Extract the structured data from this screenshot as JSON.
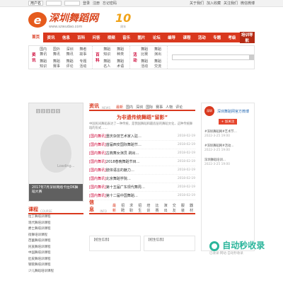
{
  "topbar": {
    "account_select": "用户名",
    "links": [
      "登录",
      "注册",
      "忘记密码"
    ],
    "right_links": [
      "关于我们",
      "加入收藏",
      "关注我们"
    ],
    "weixin": "微信微博"
  },
  "header": {
    "logo_letter": "e",
    "site_name": "深圳舞蹈网",
    "site_url": "www.szwudao.com",
    "anniv_number": "10",
    "anniv_sub": "周年"
  },
  "nav": {
    "items": [
      "首页",
      "资讯",
      "信息",
      "百科",
      "问答",
      "视频",
      "音乐",
      "图片",
      "论坛",
      "编导",
      "课程",
      "活动",
      "专题",
      "考级"
    ],
    "category": "培训导航"
  },
  "subnav": {
    "groups": [
      {
        "head": "资讯",
        "items": [
          "国内舞讯",
          "国外舞讯",
          "深圳舞讯",
          "舞者故事",
          "舞蹈知识",
          "舞蹈赛事",
          "舞蹈评论",
          "专题活动"
        ]
      },
      {
        "head": "百科",
        "items": [
          "舞蹈知识",
          "舞蹈种类",
          "舞蹈名人",
          "舞蹈术语"
        ]
      },
      {
        "head": "活动",
        "items": [
          "舞蹈比赛",
          "舞蹈演出",
          "舞蹈活动",
          "舞蹈交流"
        ]
      }
    ]
  },
  "slider": {
    "dots": [
      "1",
      "2",
      "3",
      "4",
      "5"
    ],
    "loading": "Loading...",
    "caption": "2017年7月深圳网络卡拉OK舞蹈大赛"
  },
  "news": {
    "title": "资讯",
    "en": "NEWS",
    "tabs": [
      "最新",
      "国内",
      "深圳",
      "国际",
      "赛事",
      "人物",
      "评论"
    ],
    "headline": "为非遗传统舞蹈“留影”",
    "summary": "中国民间舞蹈表达了一种传统，是我国舞蹈和最底层的舞蹈文化，这种传统舞蹈的形式……",
    "items": [
      {
        "tag": "[国内舞讯]",
        "text": "重庆杂技艺术家入驻…",
        "date": "2018-02-19"
      },
      {
        "tag": "[国内舞讯]",
        "text": "首届西安国际舞蹈节…",
        "date": "2018-02-19"
      },
      {
        "tag": "[国内舞讯]",
        "text": "古典舞女演员 跳出…",
        "date": "2018-02-19"
      },
      {
        "tag": "[国内舞讯]",
        "text": "2018春晚舞蹈节目…",
        "date": "2018-02-19"
      },
      {
        "tag": "[国内舞讯]",
        "text": "肢体语言的魅力…",
        "date": "2018-02-19"
      },
      {
        "tag": "[国内舞讯]",
        "text": "北京舞蹈学院…",
        "date": "2018-02-19"
      },
      {
        "tag": "[国内舞讯]",
        "text": "第十五届广东现代舞周…",
        "date": "2018-02-19"
      },
      {
        "tag": "[国内舞讯]",
        "text": "第十二届中国舞蹈…",
        "date": "2018-02-19"
      }
    ]
  },
  "weibo": {
    "avatar": "深圳",
    "user": "深圳舞蹈网官方微博",
    "follow": "+ 加关注",
    "posts": [
      {
        "text": "#深圳舞蹈网#艺术节…",
        "time": "2022-3-25 19:00"
      },
      {
        "text": "#深圳舞蹈网#活动…",
        "time": "2022-3-25 19:00"
      },
      {
        "text": "深圳舞蹈培训…",
        "time": "2022-3-25 19:00"
      }
    ]
  },
  "course": {
    "title": "课程",
    "en": "COURSE",
    "items": [
      "拉丁舞培训课程",
      "现代舞培训课程",
      "爵士舞培训课程",
      "街舞培训课程",
      "芭蕾舞培训课程",
      "民族舞培训课程",
      "中国舞培训课程",
      "肚皮舞培训课程",
      "钢管舞培训课程",
      "少儿舞蹈培训课程"
    ]
  },
  "info": {
    "title": "信息",
    "en": "INFO",
    "tabs": [
      "最新",
      "招聘",
      "求职",
      "招生",
      "培训",
      "比赛",
      "演出",
      "交友",
      "服装",
      "器材"
    ],
    "cards": [
      "【招生信息】",
      "【招生信息】"
    ]
  },
  "watermark": {
    "big": "自动秒收录",
    "small": "已收录·网站·自动秒收录"
  }
}
